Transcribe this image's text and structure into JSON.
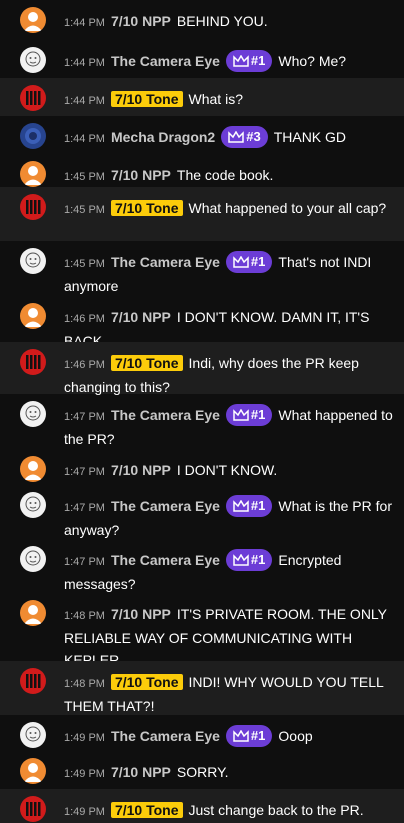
{
  "messages": [
    {
      "time": "1:44 PM",
      "author": "7/10 NPP",
      "avatar": "orange-person-avatar",
      "text": "BEHIND YOU."
    },
    {
      "time": "1:44 PM",
      "author": "The Camera Eye",
      "avatar": "sketch-face-avatar",
      "badge": "#1",
      "text": "Who? Me?"
    },
    {
      "time": "1:44 PM",
      "author": "7/10 Tone",
      "avatar": "red-logo-avatar",
      "text": "What is?"
    },
    {
      "time": "1:44 PM",
      "author": "Mecha Dragon2",
      "avatar": "blue-dragon-avatar",
      "badge": "#3",
      "text": "THANK GD"
    },
    {
      "time": "1:45 PM",
      "author": "7/10 NPP",
      "avatar": "orange-person-avatar",
      "text": "The code book."
    },
    {
      "time": "1:45 PM",
      "author": "7/10 Tone",
      "avatar": "red-logo-avatar",
      "text": "What happened to your all cap?"
    },
    {
      "time": "1:45 PM",
      "author": "The Camera Eye",
      "avatar": "sketch-face-avatar",
      "badge": "#1",
      "text": "That's not INDI anymore"
    },
    {
      "time": "1:46 PM",
      "author": "7/10 NPP",
      "avatar": "orange-person-avatar",
      "text": "I DON'T KNOW. DAMN IT, IT'S BACK."
    },
    {
      "time": "1:46 PM",
      "author": "7/10 Tone",
      "avatar": "red-logo-avatar",
      "text": "Indi, why does the PR keep changing to this?"
    },
    {
      "time": "1:47 PM",
      "author": "The Camera Eye",
      "avatar": "sketch-face-avatar",
      "badge": "#1",
      "text": "What happened to the PR?"
    },
    {
      "time": "1:47 PM",
      "author": "7/10 NPP",
      "avatar": "orange-person-avatar",
      "text": "I DON'T KNOW."
    },
    {
      "time": "1:47 PM",
      "author": "The Camera Eye",
      "avatar": "sketch-face-avatar",
      "badge": "#1",
      "text": "What is the PR for anyway?"
    },
    {
      "time": "1:47 PM",
      "author": "The Camera Eye",
      "avatar": "sketch-face-avatar",
      "badge": "#1",
      "text": "Encrypted messages?"
    },
    {
      "time": "1:48 PM",
      "author": "7/10 NPP",
      "avatar": "orange-person-avatar",
      "text": "IT'S PRIVATE ROOM. THE ONLY RELIABLE WAY OF COMMUNICATING WITH KEPLER."
    },
    {
      "time": "1:48 PM",
      "author": "7/10 Tone",
      "avatar": "red-logo-avatar",
      "text": "INDI! WHY WOULD YOU TELL THEM THAT?!"
    },
    {
      "time": "1:49 PM",
      "author": "The Camera Eye",
      "avatar": "sketch-face-avatar",
      "badge": "#1",
      "text": "Ooop"
    },
    {
      "time": "1:49 PM",
      "author": "7/10 NPP",
      "avatar": "orange-person-avatar",
      "text": "SORRY."
    },
    {
      "time": "1:49 PM",
      "author": "7/10 Tone",
      "avatar": "red-logo-avatar",
      "text": "Just change back to the PR."
    }
  ],
  "colors": {
    "background": "#0f0f0f",
    "highlight_row": "#1e1e1e",
    "tone_tag": "#fccc0a",
    "badge": "#6c3dd6",
    "timestamp": "#aaaaaa",
    "author": "#c8c8c8"
  }
}
